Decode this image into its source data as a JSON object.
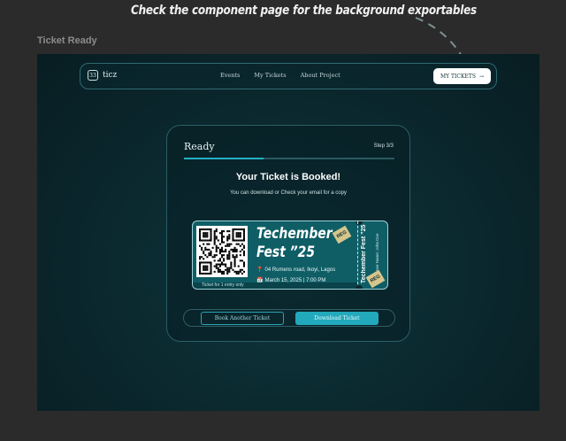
{
  "annotation": "Check the component page for the background exportables",
  "frame_label": "Ticket Ready",
  "navbar": {
    "logo_mark": "33",
    "logo_text": "ticz",
    "links": [
      "Events",
      "My Tickets",
      "About Project"
    ],
    "cta_label": "MY TICKETS",
    "cta_arrow": "→"
  },
  "card": {
    "title": "Ready",
    "step": "Step 3/3",
    "progress": 0.38,
    "heading": "Your Ticket is Booked!",
    "subtext": "You can download or Check your email for a copy",
    "ticket": {
      "event_line1": "Techember",
      "event_line2": "Fest ”25",
      "address_icon": "📍",
      "address": "04 Rumens road, Ikoyi, Lagos",
      "date_icon": "📅",
      "date": "March 15, 2025 | 7:00 PM",
      "entry_note": "Ticket for 1 entry only",
      "stub_title": "Techember Fest ”25",
      "stub_sub": "User Name: John Doe",
      "badge": "REG"
    },
    "buttons": {
      "secondary": "Book Another Ticket",
      "primary": "Download Ticket"
    }
  },
  "colors": {
    "accent": "#24b0c4",
    "background": "#0b2a30"
  }
}
